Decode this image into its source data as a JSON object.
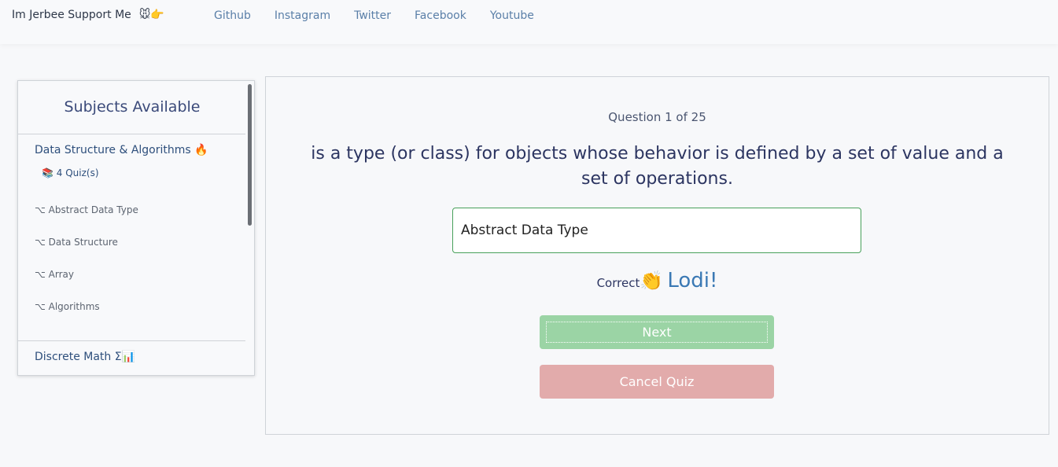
{
  "navbar": {
    "brand": "Im Jerbee Support Me",
    "brand_emoji": "🐭👉",
    "links": [
      "Github",
      "Instagram",
      "Twitter",
      "Facebook",
      "Youtube"
    ]
  },
  "sidebar": {
    "title": "Subjects Available",
    "subjects": [
      {
        "title": "Data Structure & Algorithms 🔥",
        "quiz_count": "📚 4 Quiz(s)",
        "topics": [
          "⌥ Abstract Data Type",
          "⌥ Data Structure",
          "⌥ Array",
          "⌥ Algorithms"
        ]
      },
      {
        "title": "Discrete Math Σ📊"
      }
    ]
  },
  "quiz": {
    "counter": "Question 1 of 25",
    "question": "is a type (or class) for objects whose behavior is defined by a set of value and a set of operations.",
    "answer_value": "Abstract Data Type",
    "feedback_label": "Correct",
    "feedback_emoji": "👏",
    "feedback_exclaim": "Lodi!",
    "next_label": "Next",
    "cancel_label": "Cancel Quiz"
  },
  "colors": {
    "accent_blue": "#3b79b4",
    "success_green": "#9bd4a5",
    "danger_red": "#e2abab",
    "input_border": "#48a05a"
  }
}
